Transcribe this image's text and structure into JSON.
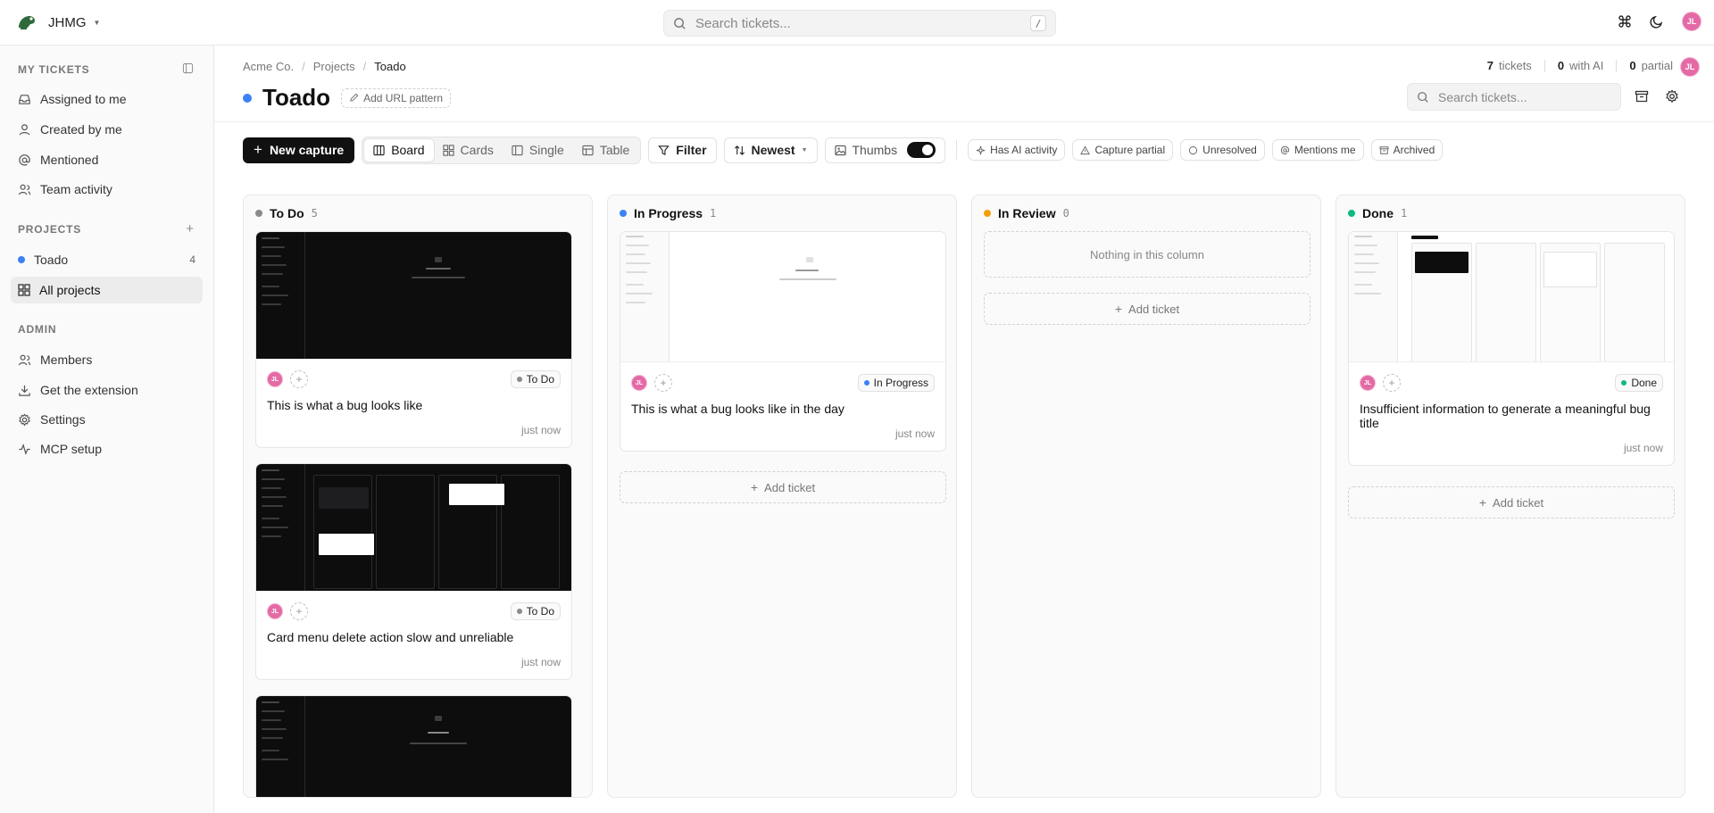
{
  "workspace": {
    "name": "JHMG"
  },
  "top_search": {
    "placeholder": "Search tickets...",
    "shortcut": "/"
  },
  "user": {
    "initials": "JL"
  },
  "sidebar": {
    "my_tickets_heading": "MY TICKETS",
    "my_tickets": [
      {
        "label": "Assigned to me",
        "icon": "inbox-icon"
      },
      {
        "label": "Created by me",
        "icon": "user-icon"
      },
      {
        "label": "Mentioned",
        "icon": "at-icon"
      },
      {
        "label": "Team activity",
        "icon": "users-icon"
      }
    ],
    "projects_heading": "PROJECTS",
    "projects": [
      {
        "label": "Toado",
        "count": "4",
        "color": "#3b82f6"
      },
      {
        "label": "All projects",
        "icon": "grid-icon"
      }
    ],
    "admin_heading": "ADMIN",
    "admin": [
      {
        "label": "Members",
        "icon": "users-icon"
      },
      {
        "label": "Get the extension",
        "icon": "download-icon"
      },
      {
        "label": "Settings",
        "icon": "gear-icon"
      },
      {
        "label": "MCP setup",
        "icon": "activity-icon"
      }
    ]
  },
  "breadcrumb": {
    "items": [
      "Acme Co.",
      "Projects",
      "Toado"
    ]
  },
  "project": {
    "title": "Toado",
    "color": "#3b82f6",
    "add_url_pattern": "Add URL pattern"
  },
  "stats": {
    "tickets_count": "7",
    "tickets_label": "tickets",
    "ai_count": "0",
    "ai_label": "with AI",
    "partial_count": "0",
    "partial_label": "partial"
  },
  "main_search": {
    "placeholder": "Search tickets..."
  },
  "toolbar": {
    "new_capture": "New capture",
    "views": [
      "Board",
      "Cards",
      "Single",
      "Table"
    ],
    "active_view": "Board",
    "filter": "Filter",
    "sort": "Newest",
    "thumbs": "Thumbs",
    "thumbs_on": true,
    "chips": [
      "Has AI activity",
      "Capture partial",
      "Unresolved",
      "Mentions me",
      "Archived"
    ]
  },
  "columns": [
    {
      "name": "To Do",
      "count": "5",
      "color": "#8a8a8e",
      "cards": [
        {
          "title": "This is what a bug looks like",
          "status": "To Do",
          "status_color": "#8a8a8e",
          "time": "just now",
          "thumb": "dark"
        },
        {
          "title": "Card menu delete action slow and unreliable",
          "status": "To Do",
          "status_color": "#8a8a8e",
          "time": "just now",
          "thumb": "dark-board"
        },
        {
          "thumb": "dark"
        }
      ]
    },
    {
      "name": "In Progress",
      "count": "1",
      "color": "#3b82f6",
      "cards": [
        {
          "title": "This is what a bug looks like in the day",
          "status": "In Progress",
          "status_color": "#3b82f6",
          "time": "just now",
          "thumb": "light"
        }
      ],
      "add_ticket": "Add ticket"
    },
    {
      "name": "In Review",
      "count": "0",
      "color": "#f59e0b",
      "empty": "Nothing in this column",
      "add_ticket": "Add ticket"
    },
    {
      "name": "Done",
      "count": "1",
      "color": "#10b981",
      "cards": [
        {
          "title": "Insufficient information to generate a meaningful bug title",
          "status": "Done",
          "status_color": "#10b981",
          "time": "just now",
          "thumb": "light-board"
        }
      ],
      "add_ticket": "Add ticket"
    }
  ]
}
